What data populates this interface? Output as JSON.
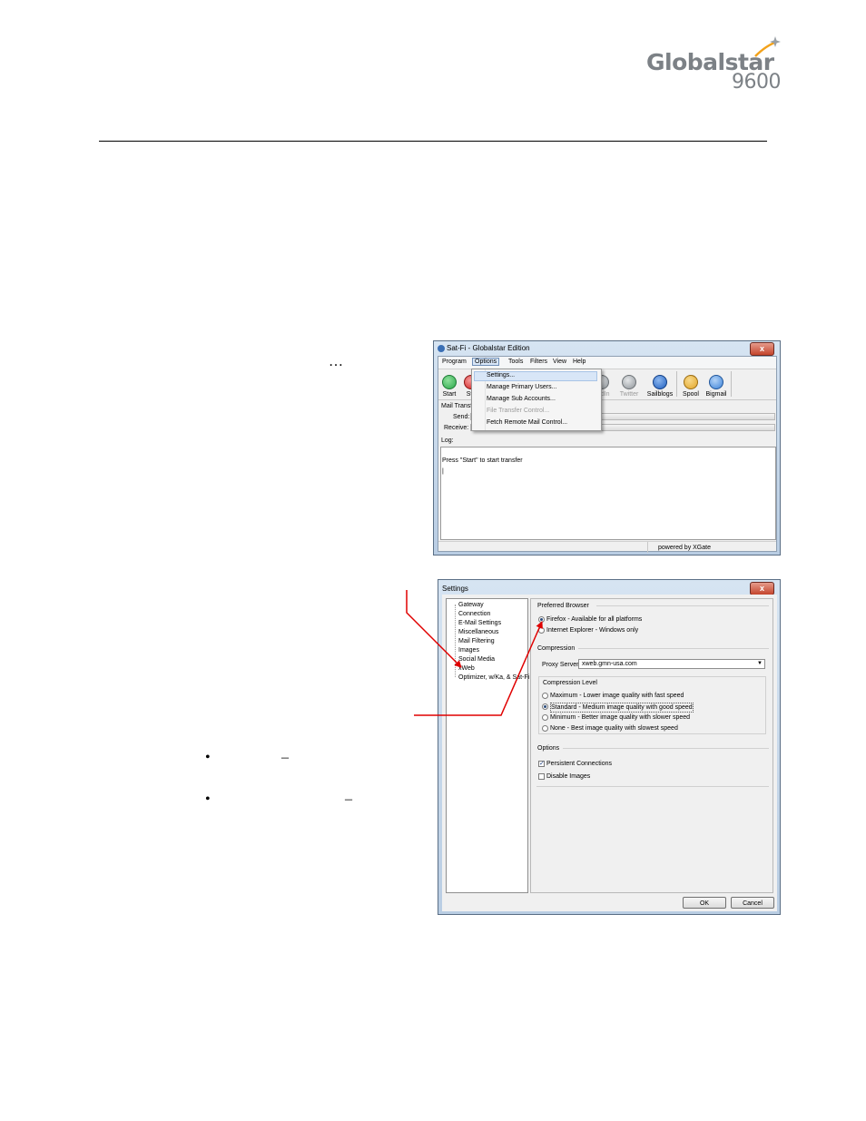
{
  "header": {
    "logo_brand": "Globalstar",
    "logo_model": "9600"
  },
  "text_fragments": {
    "ellipsis": "…",
    "bullet_1_dash": "–",
    "bullet_2_dash": "–"
  },
  "satfi_window": {
    "title": "Sat-Fi - Globalstar Edition",
    "close_label": "x",
    "menu": [
      "Program",
      "Options",
      "Tools",
      "Filters",
      "View",
      "Help"
    ],
    "toolbar": [
      {
        "label": "Start",
        "icon": "start-icon",
        "color": "#2aa84a"
      },
      {
        "label": "Sto",
        "icon": "stop-icon",
        "color": "#d22020"
      },
      {
        "label": "kedIn",
        "icon": "linkedin-icon",
        "color": "#9aa0a6"
      },
      {
        "label": "Twitter",
        "icon": "twitter-icon",
        "color": "#9aa0a6"
      },
      {
        "label": "Sailblogs",
        "icon": "sailblogs-icon",
        "color": "#1f5fbf"
      },
      {
        "label": "Spool",
        "icon": "spool-icon",
        "color": "#e1a52a"
      },
      {
        "label": "Bigmail",
        "icon": "bigmail-icon",
        "color": "#3b82d8"
      }
    ],
    "dropdown": [
      {
        "label": "Settings...",
        "disabled": false,
        "highlighted": true
      },
      {
        "label": "Manage Primary Users...",
        "disabled": false
      },
      {
        "label": "Manage Sub Accounts...",
        "disabled": false
      },
      {
        "label": "File Transfer Control...",
        "disabled": true
      },
      {
        "label": "Fetch Remote Mail Control...",
        "disabled": false
      }
    ],
    "mail_transfer_label": "Mail Transf",
    "send_label": "Send:",
    "receive_label": "Receive:",
    "log_label": "Log:",
    "log_text": "Press \"Start\" to start transfer",
    "cursor": "|",
    "status_text": "powered by XGate"
  },
  "settings_window": {
    "title": "Settings",
    "close_label": "x",
    "tree": [
      "Gateway",
      "Connection",
      "E-Mail Settings",
      "Miscellaneous",
      "Mail Filtering",
      "Images",
      "Social Media",
      "xWeb",
      "Optimizer, w/Ka, & Sat-Fi"
    ],
    "preferred_browser": {
      "heading": "Preferred Browser",
      "options": [
        {
          "label": "Firefox - Available for all platforms",
          "selected": true
        },
        {
          "label": "Internet Explorer - Windows only",
          "selected": false
        }
      ]
    },
    "compression": {
      "heading": "Compression",
      "proxy_label": "Proxy Server",
      "proxy_value": "xweb.gmn-usa.com",
      "level_heading": "Compression Level",
      "levels": [
        {
          "label": "Maximum - Lower image quality with fast speed",
          "selected": false
        },
        {
          "label": "Standard - Medium image quality with good speed",
          "selected": true
        },
        {
          "label": "Minimum - Better image quality with slower speed",
          "selected": false
        },
        {
          "label": "None - Best image quality with slowest speed",
          "selected": false
        }
      ]
    },
    "options": {
      "heading": "Options",
      "items": [
        {
          "label": "Persistent Connections",
          "checked": true
        },
        {
          "label": "Disable Images",
          "checked": false
        }
      ]
    },
    "ok_label": "OK",
    "cancel_label": "Cancel"
  },
  "colors": {
    "annotation_arrow": "#e00000",
    "window_frame": "#b9cde3",
    "highlight": "#d8e6f7"
  }
}
